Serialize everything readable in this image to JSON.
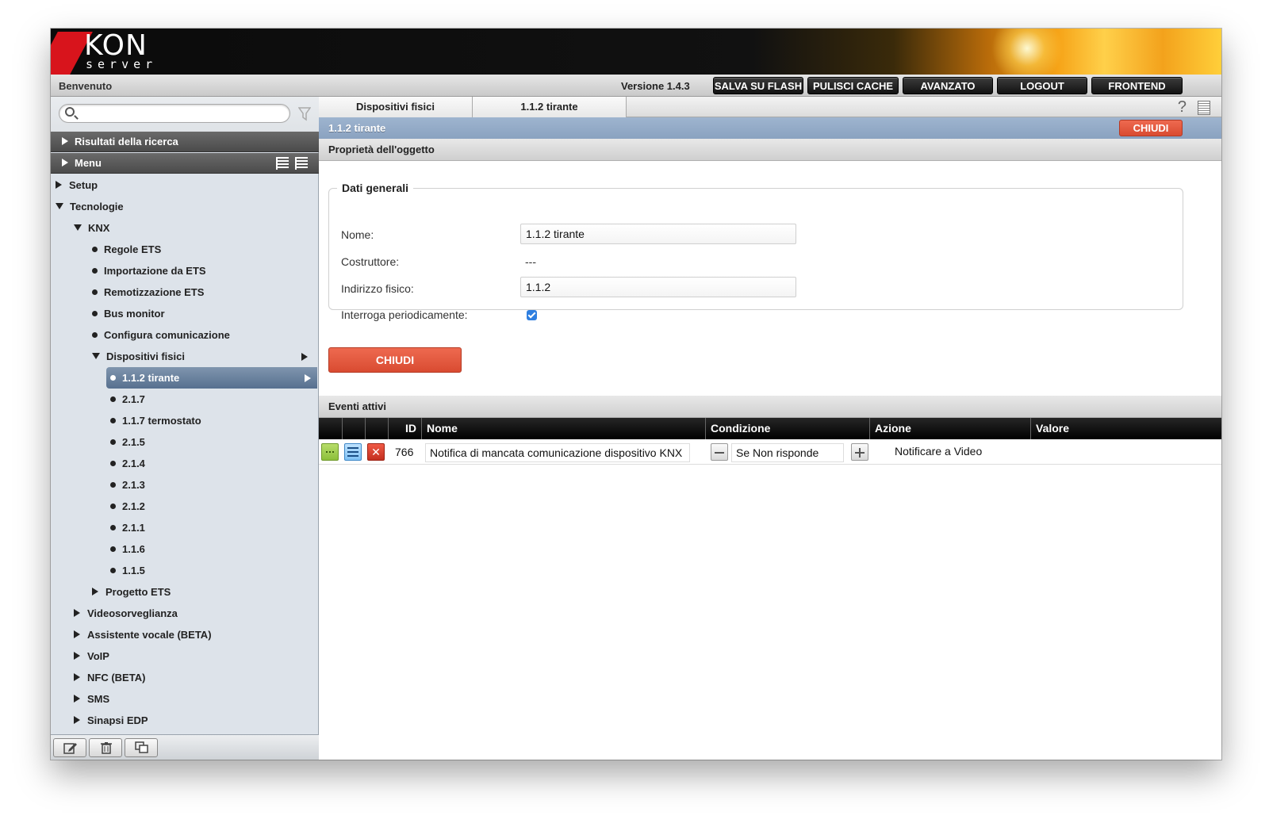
{
  "brand": {
    "logo_main": "KON",
    "logo_sub": "server"
  },
  "toolbar": {
    "welcome": "Benvenuto",
    "version": "Versione 1.4.3",
    "buttons": [
      "SALVA SU FLASH",
      "PULISCI CACHE",
      "AVANZATO",
      "LOGOUT",
      "FRONTEND"
    ]
  },
  "sidebar": {
    "search_placeholder": "",
    "sections": {
      "results": "Risultati della ricerca",
      "menu": "Menu"
    },
    "tree": [
      {
        "label": "Setup"
      },
      {
        "label": "Tecnologie"
      },
      {
        "label": "KNX"
      },
      {
        "label": "Regole ETS"
      },
      {
        "label": "Importazione da ETS"
      },
      {
        "label": "Remotizzazione ETS"
      },
      {
        "label": "Bus monitor"
      },
      {
        "label": "Configura comunicazione"
      },
      {
        "label": "Dispositivi fisici"
      },
      {
        "label": "1.1.2 tirante"
      },
      {
        "label": "2.1.7"
      },
      {
        "label": "1.1.7 termostato"
      },
      {
        "label": "2.1.5"
      },
      {
        "label": "2.1.4"
      },
      {
        "label": "2.1.3"
      },
      {
        "label": "2.1.2"
      },
      {
        "label": "2.1.1"
      },
      {
        "label": "1.1.6"
      },
      {
        "label": "1.1.5"
      },
      {
        "label": "Progetto ETS"
      },
      {
        "label": "Videosorveglianza"
      },
      {
        "label": "Assistente vocale (BETA)"
      },
      {
        "label": "VoIP"
      },
      {
        "label": "NFC (BETA)"
      },
      {
        "label": "SMS"
      },
      {
        "label": "Sinapsi EDP"
      }
    ]
  },
  "tabs": [
    "Dispositivi fisici",
    "1.1.2 tirante"
  ],
  "panel": {
    "title": "1.1.2 tirante",
    "close_label": "CHIUDI",
    "section_title": "Proprietà dell'oggetto",
    "fieldset_legend": "Dati generali",
    "fields": {
      "nome_label": "Nome:",
      "nome_value": "1.1.2 tirante",
      "costruttore_label": "Costruttore:",
      "costruttore_value": "---",
      "indirizzo_label": "Indirizzo fisico:",
      "indirizzo_value": "1.1.2",
      "interroga_label": "Interroga periodicamente:"
    },
    "interroga_checked": true,
    "close_big_label": "CHIUDI"
  },
  "events": {
    "title": "Eventi attivi",
    "columns": [
      "ID",
      "Nome",
      "Condizione",
      "Azione",
      "Valore"
    ],
    "rows": [
      {
        "id": "766",
        "nome": "Notifica di mancata comunicazione dispositivo KNX",
        "condizione": "Se Non risponde",
        "azione": "Notificare a Video",
        "valore": ""
      }
    ]
  },
  "colors": {
    "accent_red": "#d94b31",
    "selection_blue": "#57708f",
    "header_black": "#000000"
  }
}
